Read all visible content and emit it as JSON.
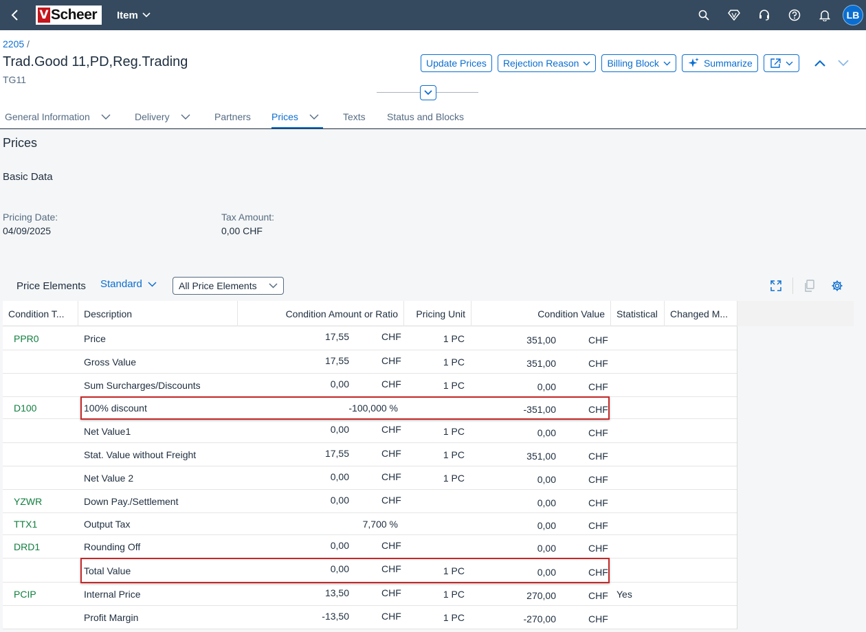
{
  "shell": {
    "logo_mark": "V",
    "logo_text": "Scheer",
    "app_title": "Item",
    "avatar_initials": "LB"
  },
  "header": {
    "breadcrumb": "2205",
    "breadcrumb_sep": "/",
    "title": "Trad.Good 11,PD,Reg.Trading",
    "subtitle": "TG11",
    "actions": {
      "update_prices": "Update Prices",
      "rejection_reason": "Rejection Reason",
      "billing_block": "Billing Block",
      "summarize": "Summarize"
    },
    "tabs": [
      {
        "label": "General Information",
        "has_menu": true
      },
      {
        "label": "Delivery",
        "has_menu": true
      },
      {
        "label": "Partners",
        "has_menu": false
      },
      {
        "label": "Prices",
        "has_menu": true,
        "active": true
      },
      {
        "label": "Texts",
        "has_menu": false
      },
      {
        "label": "Status and Blocks",
        "has_menu": false
      }
    ]
  },
  "prices": {
    "section_title": "Prices",
    "basic_data_title": "Basic Data",
    "pricing_date_label": "Pricing Date:",
    "pricing_date_value": "04/09/2025",
    "tax_amount_label": "Tax Amount:",
    "tax_amount_value": "0,00 CHF"
  },
  "price_elements": {
    "title": "Price Elements",
    "variant": "Standard",
    "filter": "All Price Elements",
    "columns": {
      "condition_type": "Condition T...",
      "description": "Description",
      "amount": "Condition Amount or Ratio",
      "pricing_unit": "Pricing Unit",
      "condition_value": "Condition Value",
      "statistical": "Statistical",
      "changed": "Changed M..."
    },
    "rows": [
      {
        "type": "PPR0",
        "desc": "Price",
        "amount": "17,55",
        "amount_cur": "CHF",
        "unit": "1 PC",
        "value": "351,00",
        "value_cur": "CHF",
        "statistical": ""
      },
      {
        "type": "",
        "desc": "Gross Value",
        "amount": "17,55",
        "amount_cur": "CHF",
        "unit": "1 PC",
        "value": "351,00",
        "value_cur": "CHF",
        "statistical": ""
      },
      {
        "type": "",
        "desc": "Sum Surcharges/Discounts",
        "amount": "0,00",
        "amount_cur": "CHF",
        "unit": "1 PC",
        "value": "0,00",
        "value_cur": "CHF",
        "statistical": ""
      },
      {
        "type": "D100",
        "desc": "100% discount",
        "ratio": "-100,000 %",
        "unit": "",
        "value": "-351,00",
        "value_cur": "CHF",
        "statistical": ""
      },
      {
        "type": "",
        "desc": "Net Value1",
        "amount": "0,00",
        "amount_cur": "CHF",
        "unit": "1 PC",
        "value": "0,00",
        "value_cur": "CHF",
        "statistical": ""
      },
      {
        "type": "",
        "desc": "Stat. Value without Freight",
        "amount": "17,55",
        "amount_cur": "CHF",
        "unit": "1 PC",
        "value": "351,00",
        "value_cur": "CHF",
        "statistical": ""
      },
      {
        "type": "",
        "desc": "Net Value 2",
        "amount": "0,00",
        "amount_cur": "CHF",
        "unit": "1 PC",
        "value": "0,00",
        "value_cur": "CHF",
        "statistical": ""
      },
      {
        "type": "YZWR",
        "desc": "Down Pay./Settlement",
        "amount": "0,00",
        "amount_cur": "CHF",
        "unit": "",
        "value": "0,00",
        "value_cur": "CHF",
        "statistical": ""
      },
      {
        "type": "TTX1",
        "desc": "Output Tax",
        "ratio": "7,700 %",
        "unit": "",
        "value": "0,00",
        "value_cur": "CHF",
        "statistical": ""
      },
      {
        "type": "DRD1",
        "desc": "Rounding Off",
        "amount": "0,00",
        "amount_cur": "CHF",
        "unit": "",
        "value": "0,00",
        "value_cur": "CHF",
        "statistical": ""
      },
      {
        "type": "",
        "desc": "Total Value",
        "amount": "0,00",
        "amount_cur": "CHF",
        "unit": "1 PC",
        "value": "0,00",
        "value_cur": "CHF",
        "statistical": ""
      },
      {
        "type": "PCIP",
        "desc": "Internal Price",
        "amount": "13,50",
        "amount_cur": "CHF",
        "unit": "1 PC",
        "value": "270,00",
        "value_cur": "CHF",
        "statistical": "Yes"
      },
      {
        "type": "",
        "desc": "Profit Margin",
        "amount": "-13,50",
        "amount_cur": "CHF",
        "unit": "1 PC",
        "value": "-270,00",
        "value_cur": "CHF",
        "statistical": ""
      }
    ],
    "highlighted_rows": [
      3,
      10
    ]
  },
  "colors": {
    "shell_bg": "#354a5f",
    "accent": "#0a6ed1",
    "condition_type": "#107e3e",
    "highlight": "#c62828"
  }
}
